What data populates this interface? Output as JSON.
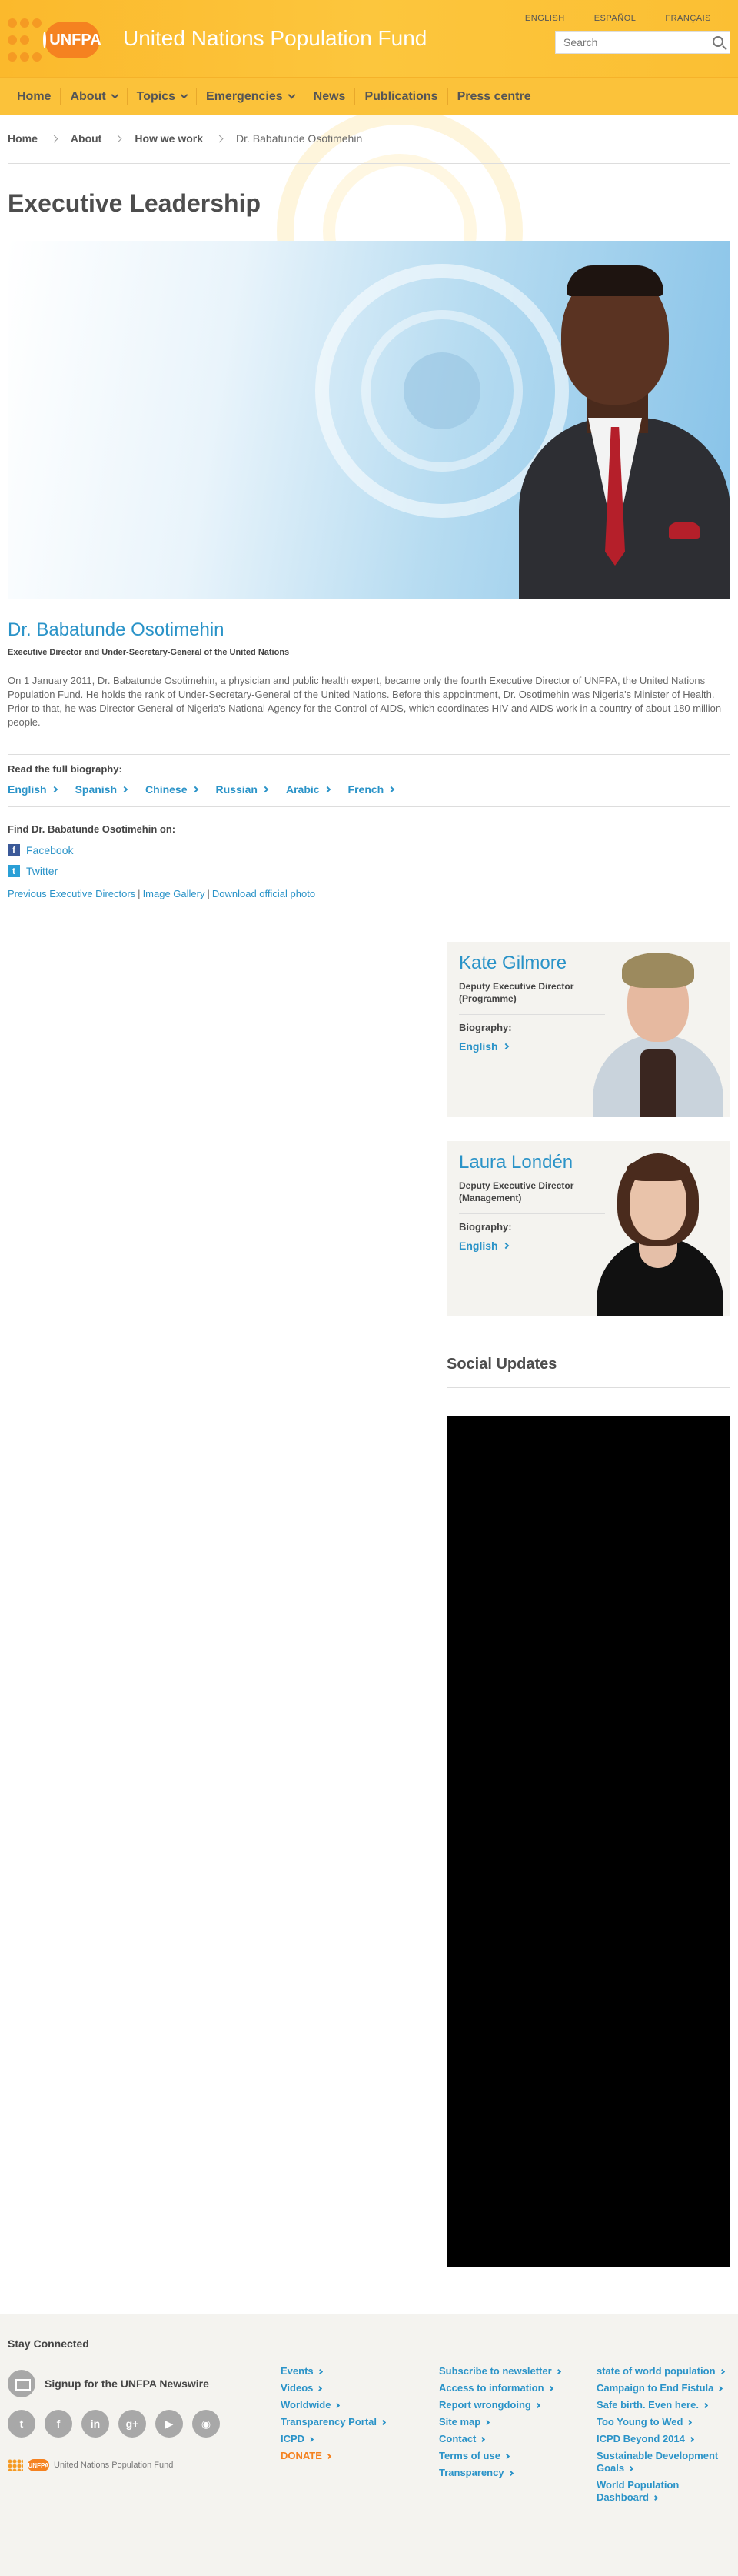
{
  "header": {
    "site_name": "United Nations Population Fund",
    "logo_text": "UNFPA",
    "languages": [
      "ENGLISH",
      "ESPAÑOL",
      "FRANÇAIS"
    ],
    "search_placeholder": "Search",
    "brand_color": "#fbc23a",
    "accent_color": "#f58220"
  },
  "nav": [
    {
      "label": "Home",
      "has_dropdown": false
    },
    {
      "label": "About",
      "has_dropdown": true
    },
    {
      "label": "Topics",
      "has_dropdown": true
    },
    {
      "label": "Emergencies",
      "has_dropdown": true
    },
    {
      "label": "News",
      "has_dropdown": false
    },
    {
      "label": "Publications",
      "has_dropdown": false
    },
    {
      "label": "Press centre",
      "has_dropdown": false
    }
  ],
  "breadcrumb": {
    "items": [
      "Home",
      "About",
      "How we work"
    ],
    "current": "Dr. Babatunde Osotimehin"
  },
  "page_title": "Executive Leadership",
  "leader": {
    "name": "Dr. Babatunde Osotimehin",
    "title": "Executive Director and Under-Secretary-General of the United Nations",
    "bio": "On 1 January 2011, Dr. Babatunde Osotimehin, a physician and public health expert, became only the fourth Executive Director of UNFPA, the United Nations Population Fund. He holds the rank of Under-Secretary-General of the United Nations. Before this appointment, Dr. Osotimehin was Nigeria's Minister of Health. Prior to that, he was Director-General of Nigeria's National Agency for the Control of AIDS, which coordinates HIV and AIDS work in a country of about 180 million people.",
    "read_full_label": "Read the full biography:",
    "bio_languages": [
      "English",
      "Spanish",
      "Chinese",
      "Russian",
      "Arabic",
      "French"
    ],
    "find_on_label": "Find Dr. Babatunde Osotimehin on:",
    "facebook_label": "Facebook",
    "twitter_label": "Twitter",
    "extra_links": [
      "Previous Executive Directors",
      "Image Gallery",
      "Download official photo"
    ]
  },
  "deputies": [
    {
      "name": "Kate Gilmore",
      "role": "Deputy Executive Director (Programme)",
      "biography_label": "Biography:",
      "link": "English"
    },
    {
      "name": "Laura Londén",
      "role": "Deputy Executive Director (Management)",
      "biography_label": "Biography:",
      "link": "English"
    }
  ],
  "social_updates_title": "Social Updates",
  "footer": {
    "stay_connected": "Stay Connected",
    "signup_label": "Signup for the UNFPA Newswire",
    "social_icons": [
      "twitter-icon",
      "facebook-icon",
      "linkedin-icon",
      "googleplus-icon",
      "youtube-icon",
      "rss-icon"
    ],
    "logo_text": "United Nations Population Fund",
    "logo_badge": "UNFPA",
    "col1": [
      "Events",
      "Videos",
      "Worldwide",
      "Transparency Portal",
      "ICPD",
      "DONATE"
    ],
    "col2": [
      "Subscribe to newsletter",
      "Access to information",
      "Report wrongdoing",
      "Site map",
      "Contact",
      "Terms of use",
      "Transparency"
    ],
    "col3": [
      "state of world population",
      "Campaign to End Fistula",
      "Safe birth. Even here.",
      "Too Young to Wed",
      "ICPD Beyond 2014",
      "Sustainable Development Goals",
      "World Population Dashboard"
    ]
  }
}
